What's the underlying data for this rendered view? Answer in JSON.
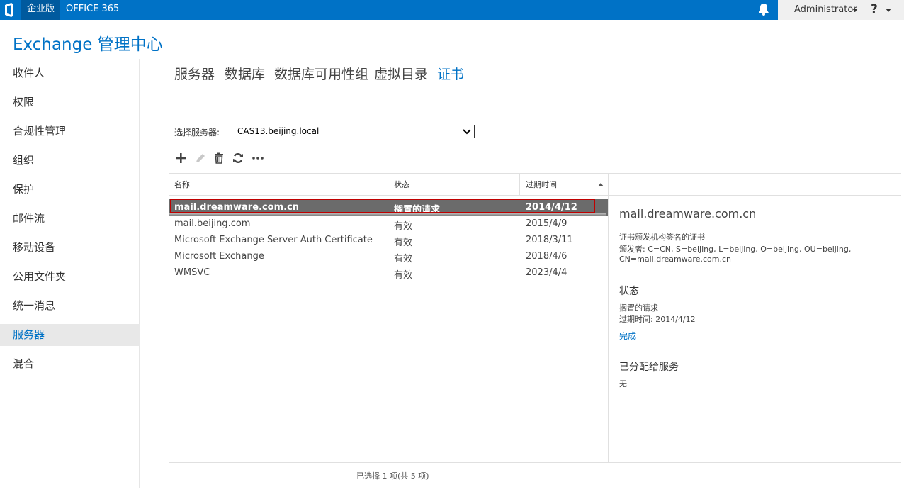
{
  "topbar": {
    "edition": "企业版",
    "office": "OFFICE 365",
    "user": "Administrator",
    "help": "?"
  },
  "app": {
    "title": "Exchange 管理中心"
  },
  "nav": {
    "items": [
      {
        "label": "收件人"
      },
      {
        "label": "权限"
      },
      {
        "label": "合规性管理"
      },
      {
        "label": "组织"
      },
      {
        "label": "保护"
      },
      {
        "label": "邮件流"
      },
      {
        "label": "移动设备"
      },
      {
        "label": "公用文件夹"
      },
      {
        "label": "统一消息"
      },
      {
        "label": "服务器"
      },
      {
        "label": "混合"
      }
    ],
    "active_index": 9
  },
  "tabs": [
    {
      "label": "服务器"
    },
    {
      "label": "数据库"
    },
    {
      "label": "数据库可用性组"
    },
    {
      "label": "虚拟目录"
    },
    {
      "label": "证书"
    }
  ],
  "server_select": {
    "label": "选择服务器:",
    "value": "CAS13.beijing.local"
  },
  "toolbar": {
    "icons": [
      "add-icon",
      "edit-icon",
      "delete-icon",
      "refresh-icon",
      "more-icon"
    ]
  },
  "grid": {
    "columns": [
      "名称",
      "状态",
      "过期时间"
    ],
    "rows": [
      {
        "name": "mail.dreamware.com.cn",
        "status": "搁置的请求",
        "expires": "2014/4/12"
      },
      {
        "name": "mail.beijing.com",
        "status": "有效",
        "expires": "2015/4/9"
      },
      {
        "name": "Microsoft Exchange Server Auth Certificate",
        "status": "有效",
        "expires": "2018/3/11"
      },
      {
        "name": "Microsoft Exchange",
        "status": "有效",
        "expires": "2018/4/6"
      },
      {
        "name": "WMSVC",
        "status": "有效",
        "expires": "2023/4/4"
      }
    ],
    "footer": "已选择 1 项(共 5 项)"
  },
  "details": {
    "title": "mail.dreamware.com.cn",
    "cert_type": "证书颁发机构签名的证书",
    "issuer_line1": "颁发者: C=CN, S=beijing, L=beijing, O=beijing, OU=beijing,",
    "issuer_line2": "CN=mail.dreamware.com.cn",
    "status_head": "状态",
    "status_value": "搁置的请求",
    "expires_line": "过期时间: 2014/4/12",
    "complete_link": "完成",
    "services_head": "已分配给服务",
    "services_value": "无"
  },
  "colors": {
    "brand": "#0072c6",
    "selected_row": "#6b6b6b",
    "highlight_outline": "#c00000"
  }
}
